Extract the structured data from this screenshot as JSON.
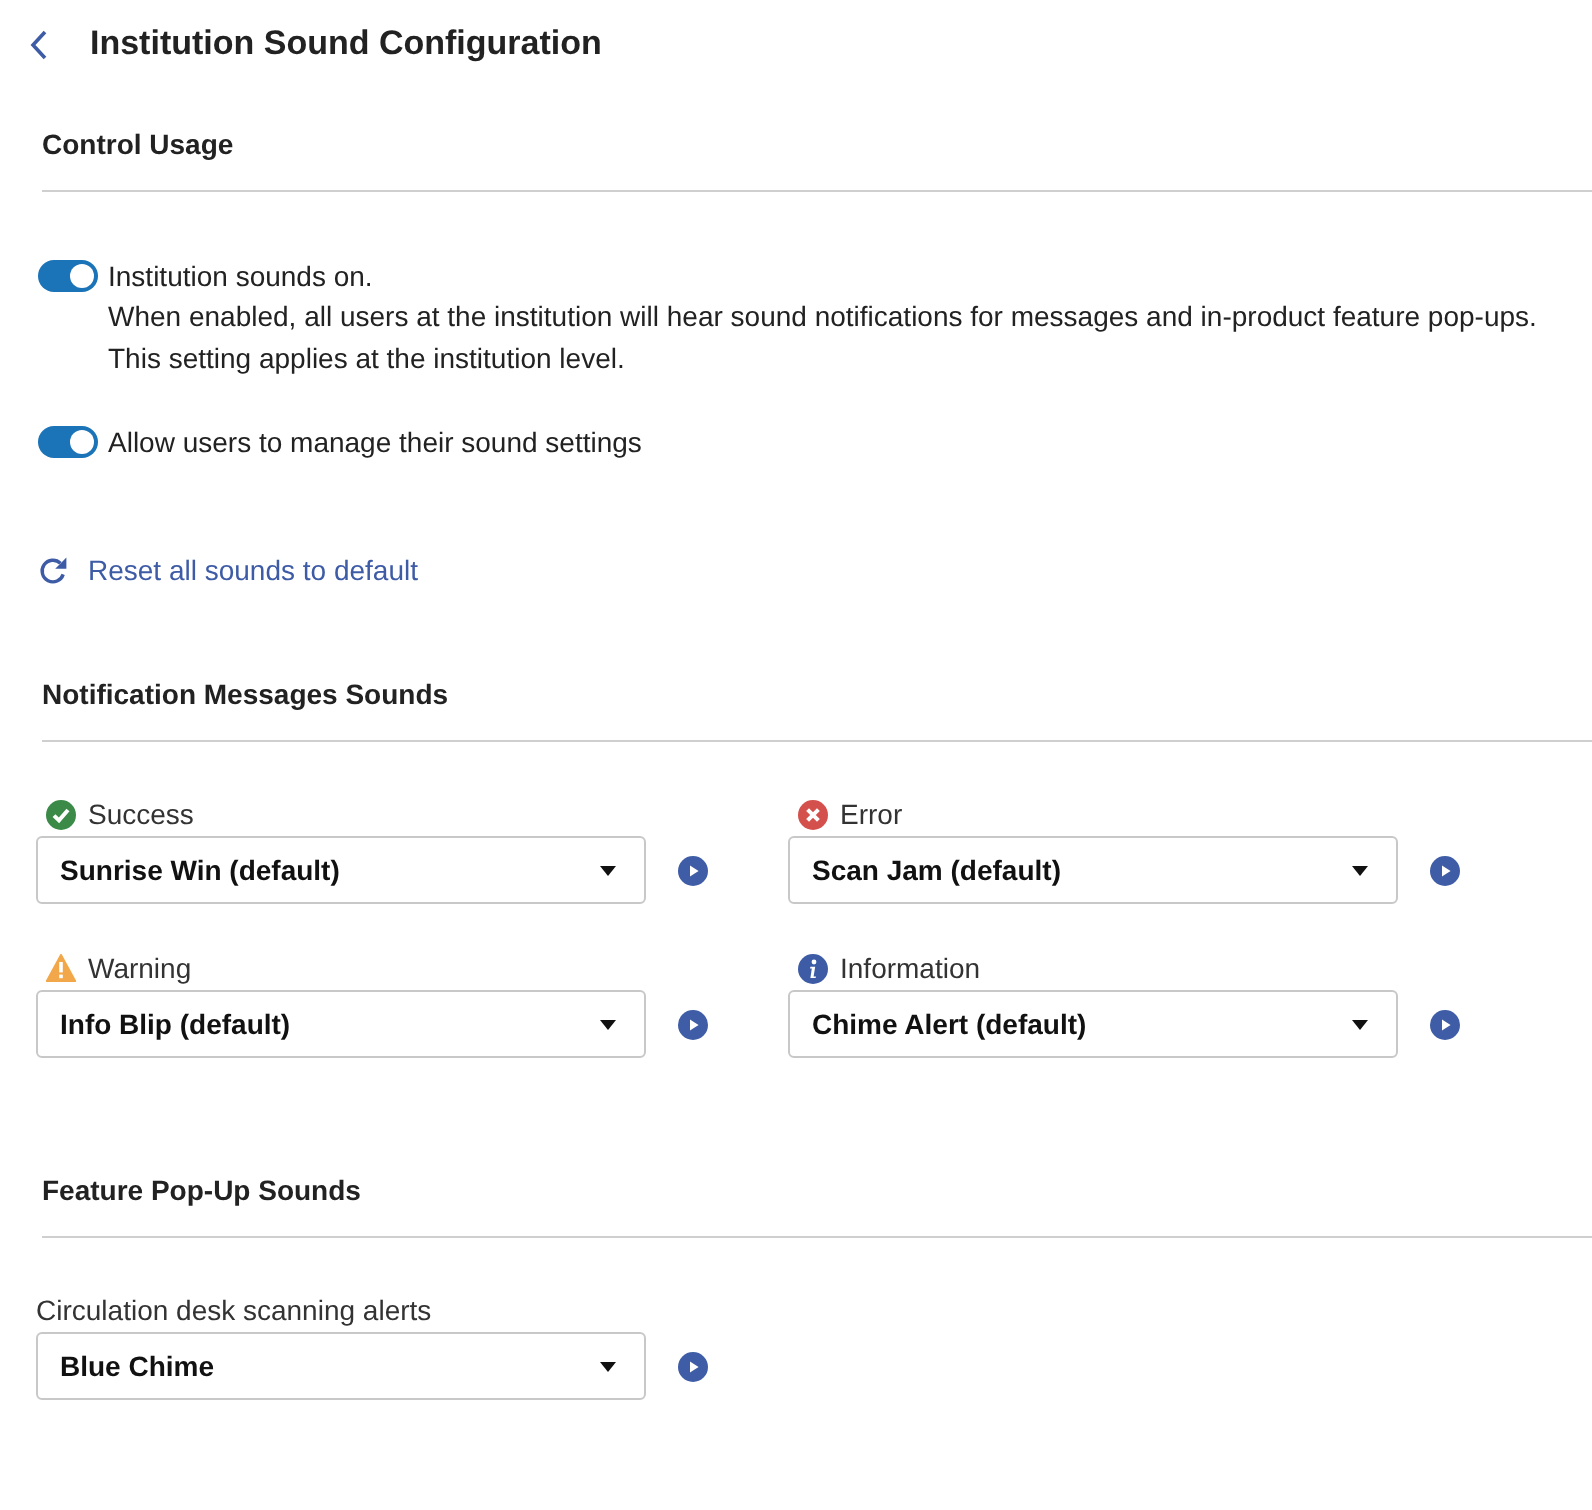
{
  "header": {
    "title": "Institution Sound Configuration"
  },
  "control_usage": {
    "heading": "Control Usage",
    "toggles": [
      {
        "label": "Institution sounds on.",
        "description": [
          "When enabled, all users at the institution will hear sound notifications for messages and in-product feature pop-ups.",
          "This setting applies at the institution level."
        ],
        "on": true
      },
      {
        "label": "Allow users to manage their sound settings",
        "on": true
      }
    ]
  },
  "reset_link": {
    "label": "Reset all sounds to default"
  },
  "notification_sounds": {
    "heading": "Notification Messages Sounds",
    "items": [
      {
        "kind": "success",
        "label": "Success",
        "value": "Sunrise Win (default)"
      },
      {
        "kind": "error",
        "label": "Error",
        "value": "Scan Jam (default)"
      },
      {
        "kind": "warning",
        "label": "Warning",
        "value": "Info Blip (default)"
      },
      {
        "kind": "information",
        "label": "Information",
        "value": "Chime Alert (default)"
      }
    ]
  },
  "feature_popup_sounds": {
    "heading": "Feature Pop-Up Sounds",
    "items": [
      {
        "label": "Circulation desk scanning alerts",
        "value": "Blue Chime"
      }
    ]
  }
}
